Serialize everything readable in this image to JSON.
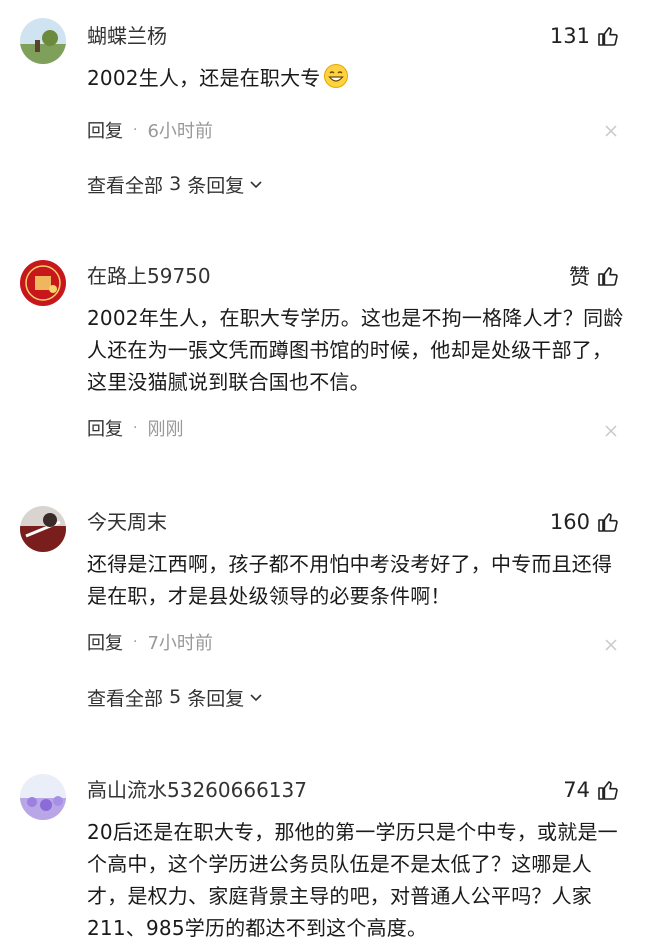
{
  "comments": [
    {
      "username": "蝴蝶兰杨",
      "likes": "131",
      "text": "2002生人，还是在职大专",
      "emoji": "grinning-face-emoji",
      "reply_label": "回复",
      "time": "6小时前",
      "view_replies": {
        "prefix": "查看全部",
        "count": "3",
        "suffix": "条回复"
      }
    },
    {
      "username": "在路上59750",
      "likes": "赞",
      "text": "2002年生人，在职大专学历。这也是不拘一格降人才？同龄人还在为一張文凭而蹲图书馆的时候，他却是处级干部了，这里没猫腻说到联合国也不信。",
      "reply_label": "回复",
      "time": "刚刚"
    },
    {
      "username": "今天周末",
      "likes": "160",
      "text": "还得是江西啊，孩子都不用怕中考没考好了，中专而且还得是在职，才是县处级领导的必要条件啊！",
      "reply_label": "回复",
      "time": "7小时前",
      "view_replies": {
        "prefix": "查看全部",
        "count": "5",
        "suffix": "条回复"
      }
    },
    {
      "username": "高山流水53260666137",
      "likes": "74",
      "text": "20后还是在职大专，那他的第一学历只是个中专，或就是一个高中，这个学历进公务员队伍是不是太低了？这哪是人才，是权力、家庭背景主导的吧，对普通人公平吗？人家211、985学历的都达不到这个高度。"
    }
  ],
  "icons": {
    "like": "thumbs-up-icon",
    "close": "close-icon",
    "chevron": "chevron-down-icon"
  },
  "colors": {
    "text": "#222222",
    "muted": "#999999"
  }
}
